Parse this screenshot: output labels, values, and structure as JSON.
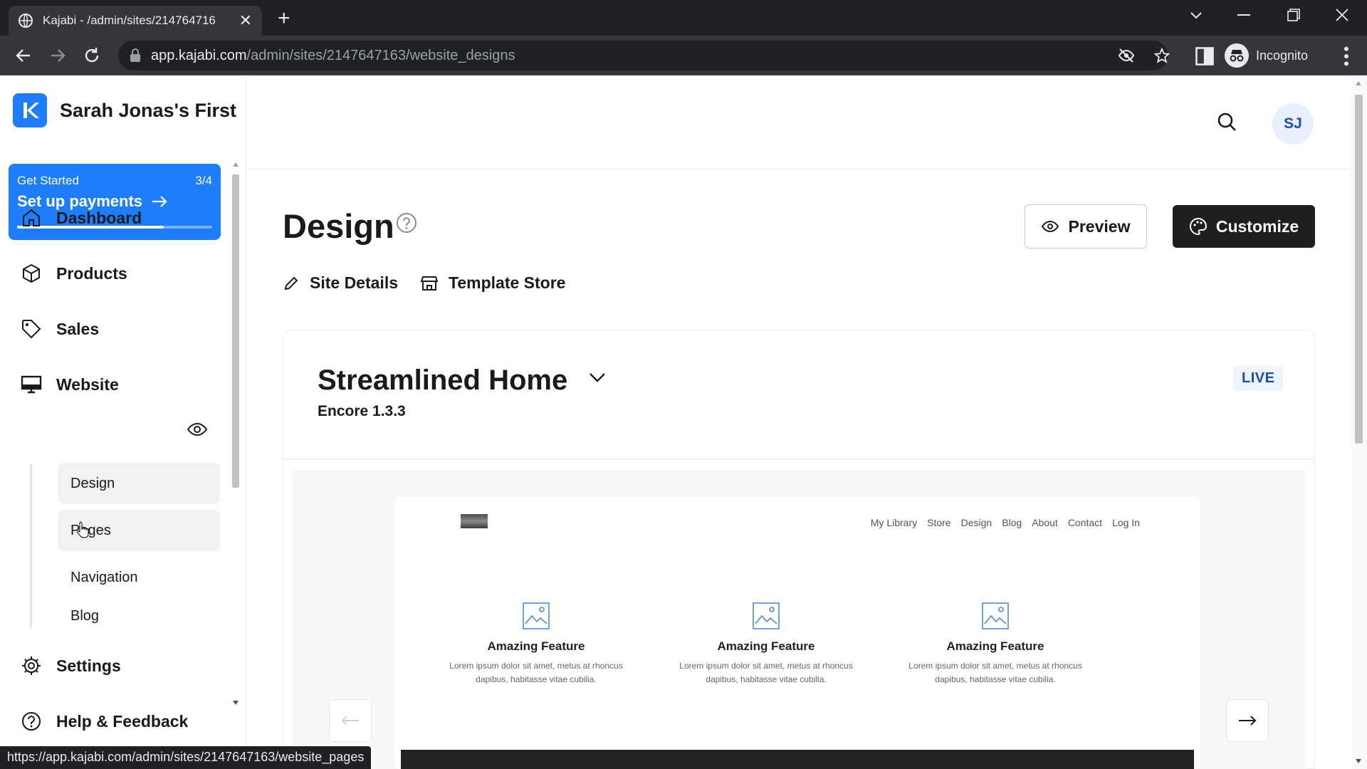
{
  "browser": {
    "tab_title": "Kajabi - /admin/sites/214764716",
    "url_host": "app.kajabi.com",
    "url_path": "/admin/sites/2147647163/website_designs",
    "profile_label": "Incognito",
    "status_url": "https://app.kajabi.com/admin/sites/2147647163/website_pages"
  },
  "sidebar": {
    "site_name": "Sarah Jonas's First",
    "get_started": {
      "label": "Get Started",
      "progress_text": "3/4",
      "action": "Set up payments",
      "progress_fraction": 0.75
    },
    "items": [
      {
        "label": "Dashboard",
        "icon": "home-icon"
      },
      {
        "label": "Products",
        "icon": "box-icon"
      },
      {
        "label": "Sales",
        "icon": "tag-icon"
      },
      {
        "label": "Website",
        "icon": "monitor-icon"
      },
      {
        "label": "Settings",
        "icon": "gear-icon"
      },
      {
        "label": "Help & Feedback",
        "icon": "help-circle-icon"
      }
    ],
    "website_subitems": [
      "Design",
      "Pages",
      "Navigation",
      "Blog"
    ]
  },
  "header": {
    "avatar_initials": "SJ"
  },
  "page": {
    "title": "Design",
    "preview_label": "Preview",
    "customize_label": "Customize",
    "site_details_label": "Site Details",
    "template_store_label": "Template Store"
  },
  "theme": {
    "name": "Streamlined Home",
    "version": "Encore 1.3.3",
    "status": "LIVE"
  },
  "mini_site": {
    "nav": [
      "My Library",
      "Store",
      "Design",
      "Blog",
      "About",
      "Contact",
      "Log In"
    ],
    "features": [
      {
        "title": "Amazing Feature",
        "desc1": "Lorem ipsum dolor sit amet, metus at rhoncus",
        "desc2": "dapibus, habitasse vitae cubilia."
      },
      {
        "title": "Amazing Feature",
        "desc1": "Lorem ipsum dolor sit amet, metus at rhoncus",
        "desc2": "dapibus, habitasse vitae cubilia."
      },
      {
        "title": "Amazing Feature",
        "desc1": "Lorem ipsum dolor sit amet, metus at rhoncus",
        "desc2": "dapibus, habitasse vitae cubilia."
      }
    ]
  },
  "colors": {
    "brand_blue": "#1d7dfa",
    "dark_button": "#1f1f1f",
    "live_badge_text": "#1a4fa3"
  }
}
